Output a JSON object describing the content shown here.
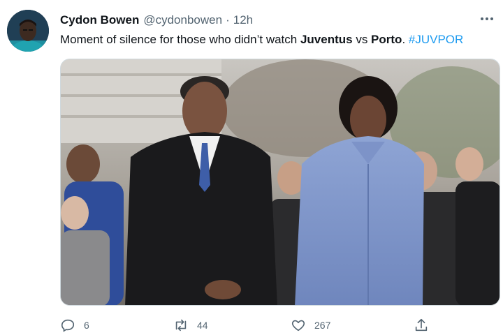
{
  "tweet": {
    "author_name": "Cydon Bowen",
    "author_handle": "@cydonbowen",
    "separator": "·",
    "time": "12h",
    "text_parts": {
      "intro": "Moment of silence for those who didn’t watch ",
      "team1": "Juventus",
      "vs": " vs ",
      "team2": "Porto",
      "period": ". ",
      "hashtag": "#JUVPOR"
    }
  },
  "actions": {
    "reply_count": "6",
    "retweet_count": "44",
    "like_count": "267"
  },
  "icons": {
    "reply": "reply-icon",
    "retweet": "retweet-icon",
    "like": "heart-icon",
    "share": "share-icon",
    "more": "more-icon"
  },
  "colors": {
    "text": "#0f1419",
    "secondary": "#536471",
    "link": "#1d9bf0",
    "border": "#cfd9de"
  }
}
